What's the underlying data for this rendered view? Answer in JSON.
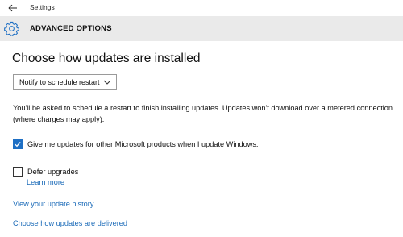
{
  "titlebar": {
    "title": "Settings"
  },
  "header": {
    "title": "ADVANCED OPTIONS",
    "icon": "gear-icon"
  },
  "main": {
    "heading": "Choose how updates are installed",
    "dropdown": {
      "selected": "Notify to schedule restart"
    },
    "info_text": "You'll be asked to schedule a restart to finish installing updates. Updates won't download over a metered connection (where charges may apply).",
    "microsoft_updates": {
      "label": "Give me updates for other Microsoft products when I update Windows.",
      "checked": true
    },
    "defer_upgrades": {
      "label": "Defer upgrades",
      "checked": false,
      "learn_more": "Learn more"
    },
    "view_history_link": "View your update history",
    "delivery_link": "Choose how updates are delivered"
  },
  "colors": {
    "accent": "#1e6fc4",
    "link": "#1a6ab8",
    "header_bg": "#eaeaea"
  }
}
